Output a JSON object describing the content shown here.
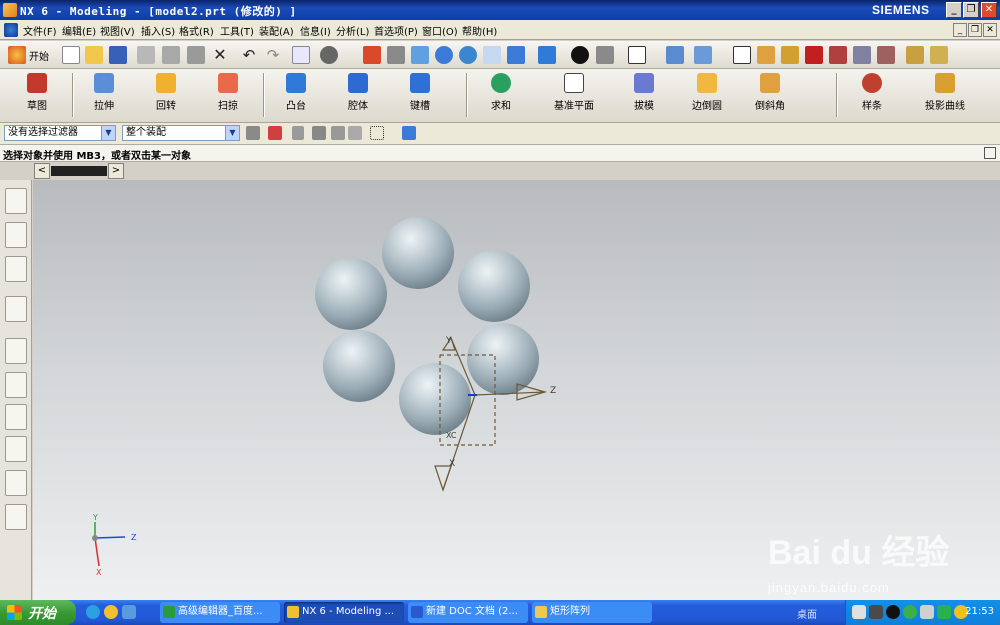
{
  "window": {
    "title": "NX 6 - Modeling - [model2.prt  (修改的) ]",
    "brand": "SIEMENS",
    "min_btn": "_",
    "restore_btn": "❐",
    "close_btn": "✕"
  },
  "menubar": {
    "items": [
      "文件(F)",
      "编辑(E)",
      "视图(V)",
      "插入(S)",
      "格式(R)",
      "工具(T)",
      "装配(A)",
      "信息(I)",
      "分析(L)",
      "首选项(P)",
      "窗口(O)",
      "帮助(H)"
    ]
  },
  "toolbar_standard": {
    "start_label": "开始"
  },
  "toolbar_features": {
    "buttons": [
      "草图",
      "拉伸",
      "回转",
      "扫掠",
      "凸台",
      "腔体",
      "键槽",
      "求和",
      "基准平面",
      "拔模",
      "边倒圆",
      "倒斜角",
      "样条",
      "投影曲线"
    ]
  },
  "selection_bar": {
    "filter_value": "没有选择过滤器",
    "scope_value": "整个装配"
  },
  "status": {
    "message": "选择对象并使用 MB3，或者双击某一对象"
  },
  "tabs": {
    "prev": "<",
    "next": ">"
  },
  "viewport": {
    "wcs_labels": {
      "x": "X",
      "y": "Y",
      "z": "Z",
      "xc": "XC"
    },
    "triad_labels": {
      "x": "X",
      "y": "Y",
      "z": "Z"
    },
    "watermark_url": "jingyan.baidu.com",
    "watermark_brand": "Bai du 经验"
  },
  "taskbar": {
    "start": "开始",
    "tasks": [
      "高级编辑器_百度...",
      "NX 6 - Modeling ...",
      "新建 DOC 文档 (2...",
      "矩形阵列"
    ],
    "desktop_label": "桌面",
    "clock": "21:53"
  }
}
